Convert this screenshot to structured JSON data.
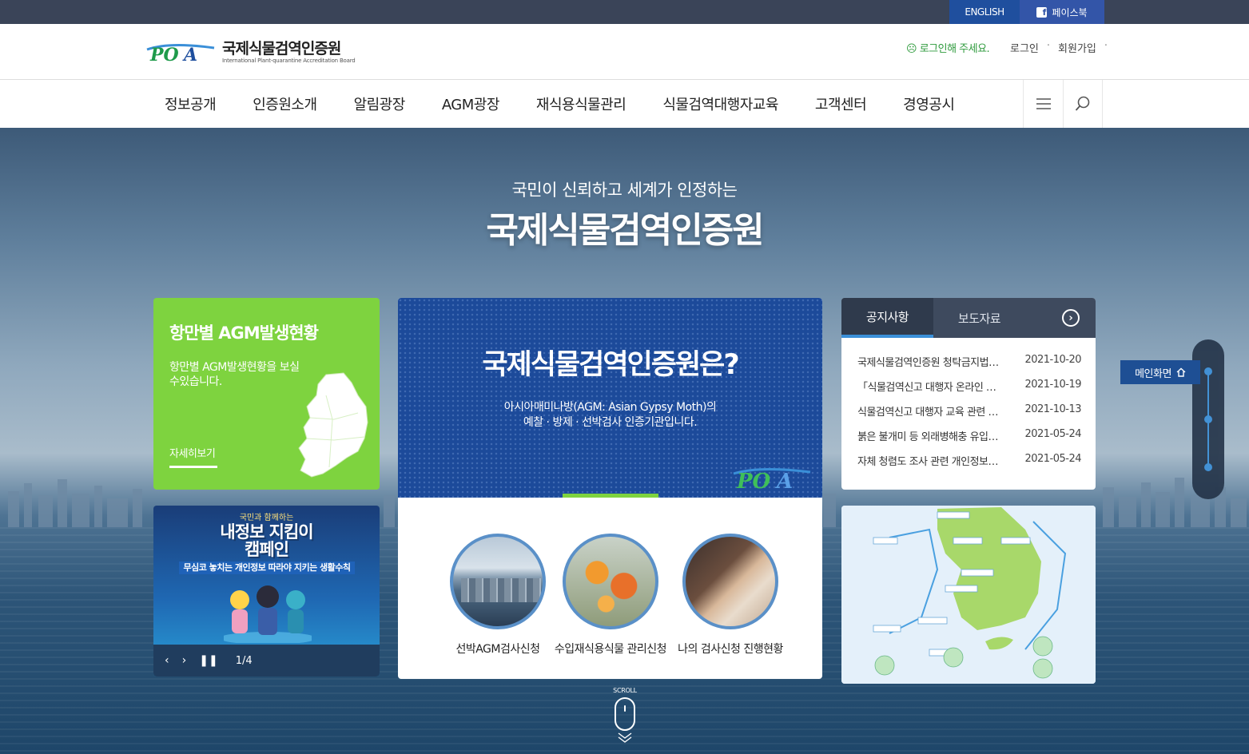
{
  "topbar": {
    "english": "ENGLISH",
    "facebook": "페이스북"
  },
  "header": {
    "logo_title": "국제식물검역인증원",
    "logo_sub": "International Plant-quarantine Accreditation Board",
    "login_msg": "로그인해 주세요.",
    "links": [
      "로그인",
      "회원가입"
    ]
  },
  "nav": {
    "items": [
      "정보공개",
      "인증원소개",
      "알림광장",
      "AGM광장",
      "재식용식물관리",
      "식물검역대행자교육",
      "고객센터",
      "경영공시"
    ]
  },
  "hero": {
    "subtitle": "국민이 신뢰하고 세계가 인정하는",
    "title": "국제식물검역인증원"
  },
  "green_card": {
    "title": "항만별 AGM발생현황",
    "desc": "항만별 AGM발생현황을 보실수있습니다.",
    "more": "자세히보기"
  },
  "campaign": {
    "small": "국민과 함께하는",
    "title_line1": "내정보 지킴이",
    "title_line2": "캠페인",
    "tag": "무심코 놓치는 개인정보 따라야 지키는 생활수칙",
    "counter": "1/4"
  },
  "center_card": {
    "title": "국제식물검역인증원은?",
    "desc_line1": "아시아매미나방(AGM: Asian Gypsy Moth)의",
    "desc_line2": "예찰 · 방제 · 선박검사 인증기관입니다.",
    "items": [
      {
        "label": "선박AGM검사신청"
      },
      {
        "label": "수입재식용식물 관리신청"
      },
      {
        "label": "나의 검사신청 진행현황"
      }
    ]
  },
  "notice": {
    "tabs": [
      "공지사항",
      "보도자료"
    ],
    "rows": [
      {
        "title": "국제식물검역인증원 청탁금지법 관련",
        "date": "2021-10-20"
      },
      {
        "title": "「식물검역신고 대행자 온라인 교육」",
        "date": "2021-10-19"
      },
      {
        "title": "식물검역신고 대행자 교육 관련 안내",
        "date": "2021-10-13"
      },
      {
        "title": "붉은 불개미 등 외래병해충 유입 차단",
        "date": "2021-05-24"
      },
      {
        "title": "자체 청렴도 조사 관련 개인정보 수집",
        "date": "2021-05-24"
      }
    ]
  },
  "side": {
    "main_button": "메인화면"
  },
  "scroll": {
    "label": "SCROLL"
  },
  "colors": {
    "green": "#7ed33f",
    "blue": "#1c4a9a",
    "topbar": "#3a4458",
    "accent": "#3a8fd8"
  }
}
